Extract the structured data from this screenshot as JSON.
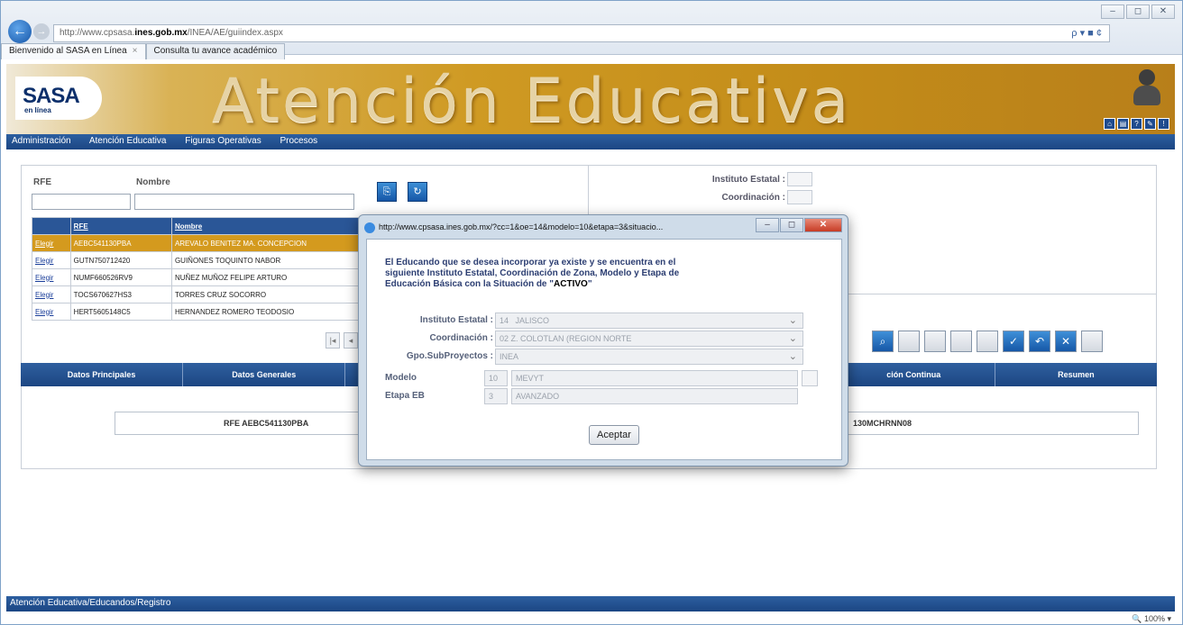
{
  "browser": {
    "url_prefix": "http://www.cpsasa.",
    "url_domain": "ines.gob.mx",
    "url_suffix": "/INEA/AE/guiindex.aspx",
    "url_tools": "ρ ▾ ■ ¢",
    "tabs": [
      {
        "label": "Bienvenido al SASA en Línea"
      },
      {
        "label": "Consulta tu avance académico"
      }
    ]
  },
  "banner": {
    "logo": "SASA",
    "logo_sub": "en línea",
    "title": "Atención Educativa"
  },
  "menu": [
    "Administración",
    "Atención Educativa",
    "Figuras Operativas",
    "Procesos"
  ],
  "search": {
    "rfe_label": "RFE",
    "nombre_label": "Nombre",
    "rfe_value": "",
    "nombre_value": ""
  },
  "results": {
    "columns": [
      "",
      "RFE",
      "Nombre"
    ],
    "rows": [
      {
        "action": "Elegir",
        "rfe": "AEBC541130PBA",
        "nombre": "AREVALO BENITEZ MA. CONCEPCION",
        "selected": true
      },
      {
        "action": "Elegir",
        "rfe": "GUTN750712420",
        "nombre": "GUIÑONES TOQUINTO NABOR",
        "selected": false
      },
      {
        "action": "Elegir",
        "rfe": "NUMF660526RV9",
        "nombre": "NUÑEZ MUÑOZ FELIPE ARTURO",
        "selected": false
      },
      {
        "action": "Elegir",
        "rfe": "TOCS670627HS3",
        "nombre": "TORRES CRUZ SOCORRO",
        "selected": false
      },
      {
        "action": "Elegir",
        "rfe": "HERT5605148C5",
        "nombre": "HERNANDEZ ROMERO TEODOSIO",
        "selected": false
      }
    ]
  },
  "right_panel": {
    "instituto_label": "Instituto Estatal :",
    "coordinacion_label": "Coordinación :"
  },
  "sections": [
    "Datos Principales",
    "Datos Generales",
    "",
    "",
    "",
    "ción Continua",
    "Resumen"
  ],
  "info": {
    "rfe_text": "RFE AEBC541130PBA",
    "curp_text": "130MCHRNN08"
  },
  "status": {
    "breadcrumb": "Atención Educativa/Educandos/Registro",
    "zoom": "100%"
  },
  "modal": {
    "title": "http://www.cpsasa.ines.gob.mx/?cc=1&oe=14&modelo=10&etapa=3&situacio...",
    "message_1": "El Educando que se desea incorporar ya existe y se encuentra en el",
    "message_2": "siguiente Instituto Estatal, Coordinación de Zona, Modelo y Etapa de",
    "message_3": "Educación Básica con la Situación de \"",
    "message_status": "ACTIVO",
    "message_end": "\"",
    "fields": {
      "instituto_label": "Instituto Estatal :",
      "instituto_code": "14",
      "instituto_value": "JALISCO",
      "coordinacion_label": "Coordinación :",
      "coordinacion_value": "02 Z. COLOTLAN (REGION NORTE",
      "gpo_label": "Gpo.SubProyectos :",
      "gpo_value": "INEA",
      "modelo_label": "Modelo",
      "modelo_code": "10",
      "modelo_value": "MEVYT",
      "etapa_label": "Etapa EB",
      "etapa_code": "3",
      "etapa_value": "AVANZADO"
    },
    "accept_label": "Aceptar"
  }
}
